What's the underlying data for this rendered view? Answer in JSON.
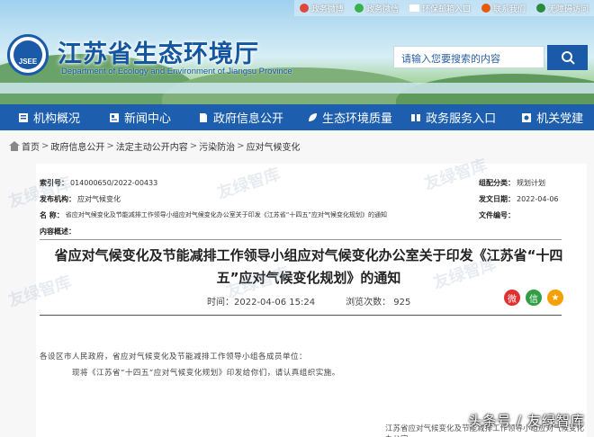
{
  "toplinks": [
    {
      "label": "政务微博",
      "icon": "weibo-icon",
      "color": "#e0463c"
    },
    {
      "label": "政务微信",
      "icon": "wechat-icon",
      "color": "#37b24d"
    },
    {
      "label": "环保邮箱入口",
      "icon": "mail-icon",
      "color": "#ffffff"
    },
    {
      "label": "联系我们",
      "icon": "phone-icon",
      "color": "#e8590c"
    },
    {
      "label": "无障碍访问",
      "icon": "accessibility-icon",
      "color": "#2b8a3e"
    }
  ],
  "header": {
    "title": "江苏省生态环境厅",
    "subtitle": "Department of Ecology and Environment of Jiangsu Province",
    "logo_text": "JSEE"
  },
  "search": {
    "placeholder": "请输入您要搜索的内容"
  },
  "nav": [
    {
      "label": "机构概况",
      "icon": "institution-icon"
    },
    {
      "label": "新闻中心",
      "icon": "news-icon"
    },
    {
      "label": "政府信息公开",
      "icon": "document-icon"
    },
    {
      "label": "生态环境质量",
      "icon": "leaf-icon"
    },
    {
      "label": "政务服务入口",
      "icon": "service-icon"
    },
    {
      "label": "机关党建",
      "icon": "party-icon"
    }
  ],
  "breadcrumb": [
    "首页",
    "政府信息公开",
    "法定主动公开内容",
    "污染防治",
    "应对气候变化"
  ],
  "meta": {
    "index_label": "索引号：",
    "index_value": "014000650/2022-00433",
    "category_label": "组配分类：",
    "category_value": "规划计划",
    "org_label": "发布机构：",
    "org_value": "应对气候变化",
    "date_label": "发文日期：",
    "date_value": "2022-04-06",
    "name_label": "名    称：",
    "name_value": "省应对气候变化及节能减排工作领导小组应对气候变化办公室关于印发《江苏省“十四五”应对气候变化规划》的通知",
    "docno_label": "文件编号：",
    "docno_value": "",
    "summary_label": "内容概述：",
    "summary_value": ""
  },
  "doc": {
    "title_line1": "省应对气候变化及节能减排工作领导小组应对气候变化办公室关于印发《江苏省“十四",
    "title_line2": "五”应对气候变化规划》的通知",
    "time": "时间：2022-04-06 15:24",
    "views": "浏览次数：   925",
    "body1": "各设区市人民政府，省应对气候变化及节能减排工作领导小组各成员单位：",
    "body2": "现将《江苏省“十四五”应对气候变化规划》印发给你们，请认真组织实施。",
    "signature": "江苏省应对气候变化及节能减排工作领导小组应对气候变化办公室"
  },
  "watermark": "友绿智库",
  "source_tag": "头条号 / 友绿智库"
}
